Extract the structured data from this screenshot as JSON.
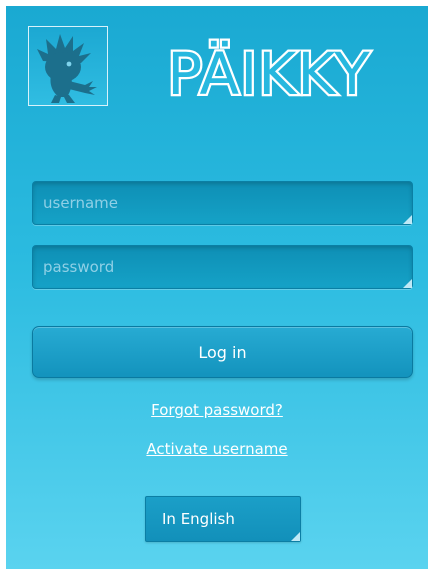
{
  "app": {
    "title": "PÄIKKY"
  },
  "login": {
    "username_placeholder": "username",
    "username_value": "",
    "password_placeholder": "password",
    "password_value": "",
    "login_label": "Log in",
    "forgot_label": "Forgot password?",
    "activate_label": "Activate username"
  },
  "language": {
    "selected": "In English"
  },
  "colors": {
    "background_top": "#1aa9d2",
    "background_bottom": "#5ad3ef",
    "field_fill": "#12a0c6",
    "button_fill": "#1a9ec8",
    "text": "#ffffff",
    "placeholder": "#8fd0e6"
  },
  "icons": {
    "logo": "spiky-haired-creature-logo",
    "field_corner": "resize-corner-icon",
    "language_corner": "dropdown-corner-icon"
  }
}
